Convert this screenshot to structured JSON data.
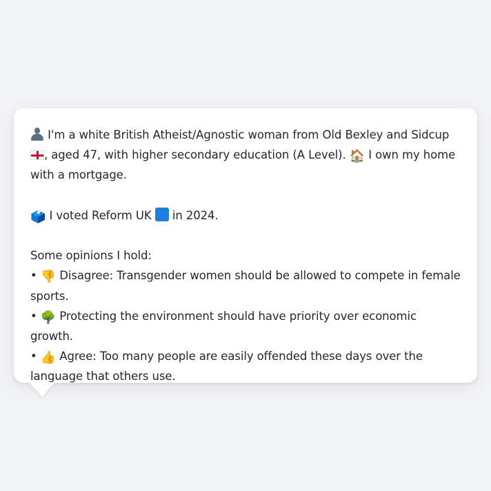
{
  "bio": {
    "icons": {
      "person": "person-silhouette",
      "flag": "england-flag",
      "home": "house"
    },
    "home_emoji": "🏠",
    "part1": " I'm a white British Atheist/Agnostic woman from Old Bexley and Sidcup ",
    "part2": ", aged 47, with higher secondary education (A Level). ",
    "part3": " I own my home with a mortgage."
  },
  "vote": {
    "ballot_emoji": "🗳️",
    "text1": " I voted Reform UK ",
    "party_color": "#1f7fe0",
    "text2": " in 2024."
  },
  "opinions": {
    "heading": "Some opinions I hold:",
    "bullet": "•",
    "items": [
      {
        "emoji": "👎",
        "text": " Disagree: Transgender women should be allowed to compete in female sports."
      },
      {
        "emoji": "🌳",
        "text": " Protecting the environment should have priority over economic growth."
      },
      {
        "emoji": "👍",
        "text": " Agree: Too many people are easily offended these days over the language that others use."
      }
    ]
  },
  "colors": {
    "background": "#f2f3f5",
    "card": "#ffffff",
    "text": "#23272e"
  }
}
